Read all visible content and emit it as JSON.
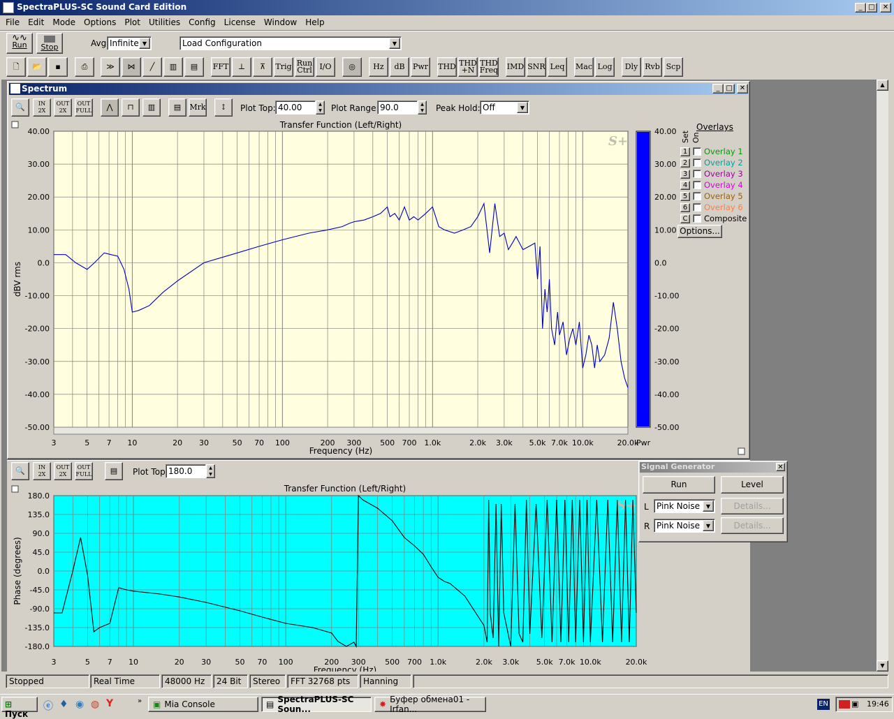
{
  "app": {
    "title": "SpectraPLUS-SC Sound Card Edition"
  },
  "menu": [
    "File",
    "Edit",
    "Mode",
    "Options",
    "Plot",
    "Utilities",
    "Config",
    "License",
    "Window",
    "Help"
  ],
  "toolbar1": {
    "run": "Run",
    "stop": "Stop",
    "avg_label": "Avg",
    "avg_value": "Infinite",
    "config_value": "Load Configuration"
  },
  "toolbar2": [
    "FFT",
    "Trig",
    "Run Ctrl",
    "I/O",
    "Hz",
    "dB",
    "Pwr",
    "THD",
    "THD +N",
    "THD Freq",
    "IMD",
    "SNR",
    "Leq",
    "Mac",
    "Log",
    "Dly",
    "Rvb",
    "Scp"
  ],
  "spectrum": {
    "title": "Spectrum",
    "plot_top_label": "Plot Top:",
    "plot_top": "40.00",
    "plot_range_label": "Plot Range:",
    "plot_range": "90.0",
    "peak_hold_label": "Peak Hold:",
    "peak_hold": "Off",
    "mrk": "Mrk",
    "overlays_title": "Overlays",
    "set_label": "Set",
    "on_label": "On",
    "overlays": [
      {
        "n": "1",
        "name": "Overlay 1",
        "color": "#00a000"
      },
      {
        "n": "2",
        "name": "Overlay 2",
        "color": "#00a0a0"
      },
      {
        "n": "3",
        "name": "Overlay 3",
        "color": "#a000a0"
      },
      {
        "n": "4",
        "name": "Overlay 4",
        "color": "#e000e0"
      },
      {
        "n": "5",
        "name": "Overlay 5",
        "color": "#a06000"
      },
      {
        "n": "6",
        "name": "Overlay 6",
        "color": "#ff8040"
      },
      {
        "n": "C",
        "name": "Composite",
        "color": "#000000"
      }
    ],
    "options_button": "Options...",
    "pwr_label": "Pwr"
  },
  "phase": {
    "plot_top_label": "Plot Top",
    "plot_top": "180.0"
  },
  "signal_gen": {
    "title": "Signal Generator",
    "run": "Run",
    "level": "Level",
    "l": "L",
    "r": "R",
    "l_val": "Pink Noise",
    "r_val": "Pink Noise",
    "details": "Details..."
  },
  "status": [
    "Stopped",
    "Real Time",
    "48000 Hz",
    "24 Bit",
    "Stereo",
    "FFT 32768 pts",
    "Hanning"
  ],
  "taskbar": {
    "start": "Пуск",
    "items": [
      "Mia Console",
      "SpectraPLUS-SC Soun...",
      "Буфер обмена01 - Irfan..."
    ],
    "lang": "EN",
    "time": "19:46"
  },
  "chart_data": [
    {
      "type": "line",
      "title": "Transfer Function (Left/Right)",
      "xlabel": "Frequency (Hz)",
      "ylabel": "dBV rms",
      "xscale": "log",
      "xlim": [
        3,
        20000
      ],
      "ylim": [
        -50,
        40
      ],
      "x_ticks": [
        "3",
        "5",
        "7",
        "10",
        "20",
        "30",
        "50",
        "70",
        "100",
        "200",
        "300",
        "500",
        "700",
        "1.0k",
        "2.0k",
        "3.0k",
        "5.0k",
        "7.0k",
        "10.0k",
        "20.0k"
      ],
      "y_ticks": [
        "40.00",
        "30.00",
        "20.00",
        "10.00",
        "0.0",
        "-10.00",
        "-20.00",
        "-30.00",
        "-40.00",
        "-50.00"
      ],
      "bar_ticks": [
        "40.00",
        "30.00",
        "20.00",
        "10.00",
        "0.0",
        "-10.00",
        "-20.00",
        "-30.00",
        "-40.00",
        "-50.00"
      ],
      "line_color": "#0000c0",
      "bg": "#ffffe0",
      "bar_color": "#0000ff",
      "bar_value": 40,
      "series": [
        {
          "x": [
            3,
            3.6,
            4.2,
            5,
            5.6,
            6.5,
            7.2,
            8,
            8.8,
            9.5,
            10,
            11,
            13,
            16,
            20,
            30,
            50,
            70,
            100,
            150,
            200,
            250,
            280,
            300,
            350,
            400,
            450,
            500,
            520,
            560,
            600,
            650,
            700,
            750,
            800,
            900,
            1000,
            1100,
            1200,
            1400,
            1600,
            1800,
            2000,
            2200,
            2400,
            2600,
            2800,
            3000,
            3200,
            3400,
            3600,
            4000,
            4400,
            4800,
            5000,
            5200,
            5400,
            5600,
            5800,
            6000,
            6200,
            6500,
            6800,
            7000,
            7400,
            7800,
            8200,
            8600,
            9000,
            9500,
            10000,
            10500,
            11000,
            11500,
            12000,
            12500,
            13000,
            14000,
            15000,
            16000,
            17000,
            18000,
            19000,
            20000
          ],
          "y": [
            2.5,
            2.5,
            0,
            -2,
            0,
            3,
            2.5,
            2,
            -2,
            -8,
            -15,
            -14.5,
            -13,
            -9,
            -5.5,
            0,
            3,
            5,
            7,
            9,
            10,
            11,
            12,
            12.5,
            13,
            14,
            15,
            17,
            14,
            15,
            13,
            17,
            13,
            14,
            13,
            15,
            17,
            11,
            10,
            9,
            10,
            11,
            14,
            18,
            3,
            18,
            8,
            9,
            4,
            6,
            8,
            4,
            5,
            6,
            -5,
            5,
            -20,
            -8,
            -15,
            -5,
            -20,
            -25,
            -15,
            -22,
            -18,
            -28,
            -23,
            -20,
            -25,
            -18,
            -32,
            -28,
            -22,
            -25,
            -32,
            -25,
            -30,
            -28,
            -23,
            -12,
            -20,
            -30,
            -35,
            -38
          ]
        }
      ]
    },
    {
      "type": "line",
      "title": "Transfer Function (Left/Right)",
      "xlabel": "Frequency (Hz)",
      "ylabel": "Phase (degrees)",
      "xscale": "log",
      "xlim": [
        3,
        20000
      ],
      "ylim": [
        -180,
        180
      ],
      "x_ticks": [
        "3",
        "5",
        "7",
        "10",
        "20",
        "30",
        "50",
        "70",
        "100",
        "200",
        "300",
        "500",
        "700",
        "1.0k",
        "2.0k",
        "3.0k",
        "5.0k",
        "7.0k",
        "10.0k",
        "20.0k"
      ],
      "y_ticks": [
        "180.0",
        "135.0",
        "90.0",
        "45.0",
        "0.0",
        "-45.0",
        "-90.0",
        "-135.0",
        "-180.0"
      ],
      "line_color": "#000000",
      "bg": "#00ffff",
      "series": [
        {
          "x": [
            3,
            3.4,
            4,
            4.5,
            5,
            5.5,
            6,
            7,
            8,
            9,
            10,
            15,
            20,
            30,
            50,
            70,
            100,
            150,
            200,
            220,
            250,
            280,
            290,
            300,
            320,
            400,
            500,
            600,
            700,
            800,
            900,
            1000,
            1100,
            1200,
            1500,
            2000,
            2100,
            2150,
            2200,
            2300,
            2400,
            2500,
            2600,
            2700,
            3000,
            3200,
            3400,
            3600,
            3800,
            4000,
            4400,
            4800,
            5200,
            5600,
            6000,
            6400,
            6800,
            7200,
            7600,
            8000,
            8500,
            9000,
            9500,
            10000,
            11000,
            12000,
            13000,
            14000,
            15000,
            16000,
            17000,
            18000,
            19000,
            20000
          ],
          "y": [
            -100,
            -100,
            0,
            80,
            -10,
            -145,
            -135,
            -125,
            -40,
            -45,
            -48,
            -55,
            -62,
            -75,
            -95,
            -110,
            -125,
            -135,
            -148,
            -168,
            -180,
            -170,
            -180,
            180,
            170,
            150,
            120,
            80,
            60,
            40,
            10,
            -15,
            -25,
            -30,
            -60,
            -130,
            -170,
            170,
            -100,
            -160,
            160,
            -180,
            160,
            -100,
            -180,
            160,
            -150,
            -170,
            170,
            -150,
            160,
            -160,
            170,
            -170,
            170,
            -170,
            170,
            -170,
            170,
            -170,
            170,
            -170,
            170,
            -170,
            170,
            -170,
            170,
            -170,
            170,
            -170,
            170,
            -170,
            170,
            -100
          ]
        }
      ]
    }
  ]
}
